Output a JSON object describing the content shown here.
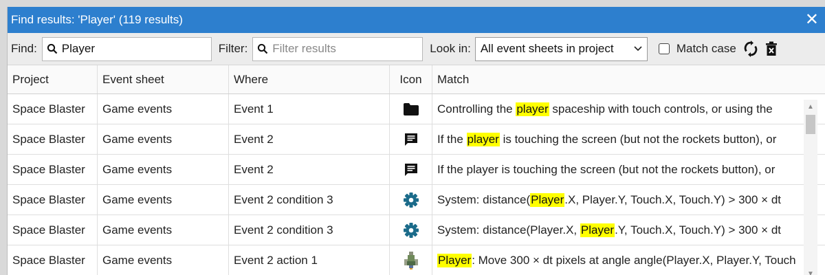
{
  "window": {
    "title": "Find results: 'Player' (119 results)",
    "close_glyph": "✕"
  },
  "toolbar": {
    "find_label": "Find:",
    "find_value": "Player",
    "filter_label": "Filter:",
    "filter_placeholder": "Filter results",
    "lookin_label": "Look in:",
    "lookin_value": "All event sheets in project",
    "matchcase_label": "Match case",
    "matchcase_checked": false
  },
  "table": {
    "columns": [
      "Project",
      "Event sheet",
      "Where",
      "Icon",
      "Match"
    ],
    "rows": [
      {
        "project": "Space Blaster",
        "sheet": "Game events",
        "where": "Event 1",
        "icon": "folder-icon",
        "match_before": "Controlling the ",
        "match_hit": "player",
        "match_after": " spaceship with touch controls, or using the"
      },
      {
        "project": "Space Blaster",
        "sheet": "Game events",
        "where": "Event 2",
        "icon": "comment-icon",
        "match_before": "If the ",
        "match_hit": "player",
        "match_after": " is touching the screen (but not the rockets button), or"
      },
      {
        "project": "Space Blaster",
        "sheet": "Game events",
        "where": "Event 2",
        "icon": "comment-icon",
        "match_before": "If the player is touching the screen (but not the rockets button), or",
        "match_hit": "",
        "match_after": ""
      },
      {
        "project": "Space Blaster",
        "sheet": "Game events",
        "where": "Event 2 condition 3",
        "icon": "gear-icon",
        "match_before": "System: distance(",
        "match_hit": "Player",
        "match_after": ".X, Player.Y, Touch.X, Touch.Y) > 300 × dt"
      },
      {
        "project": "Space Blaster",
        "sheet": "Game events",
        "where": "Event 2 condition 3",
        "icon": "gear-icon",
        "match_before": "System: distance(Player.X, ",
        "match_hit": "Player",
        "match_after": ".Y, Touch.X, Touch.Y) > 300 × dt"
      },
      {
        "project": "Space Blaster",
        "sheet": "Game events",
        "where": "Event 2 action 1",
        "icon": "spaceship-icon",
        "match_before": "",
        "match_hit": "Player",
        "match_after": ": Move 300 × dt pixels at angle angle(Player.X, Player.Y, Touch"
      }
    ]
  },
  "colors": {
    "titlebar": "#2d7fce",
    "highlight": "#ffff00",
    "gear": "#1b6b8a"
  }
}
